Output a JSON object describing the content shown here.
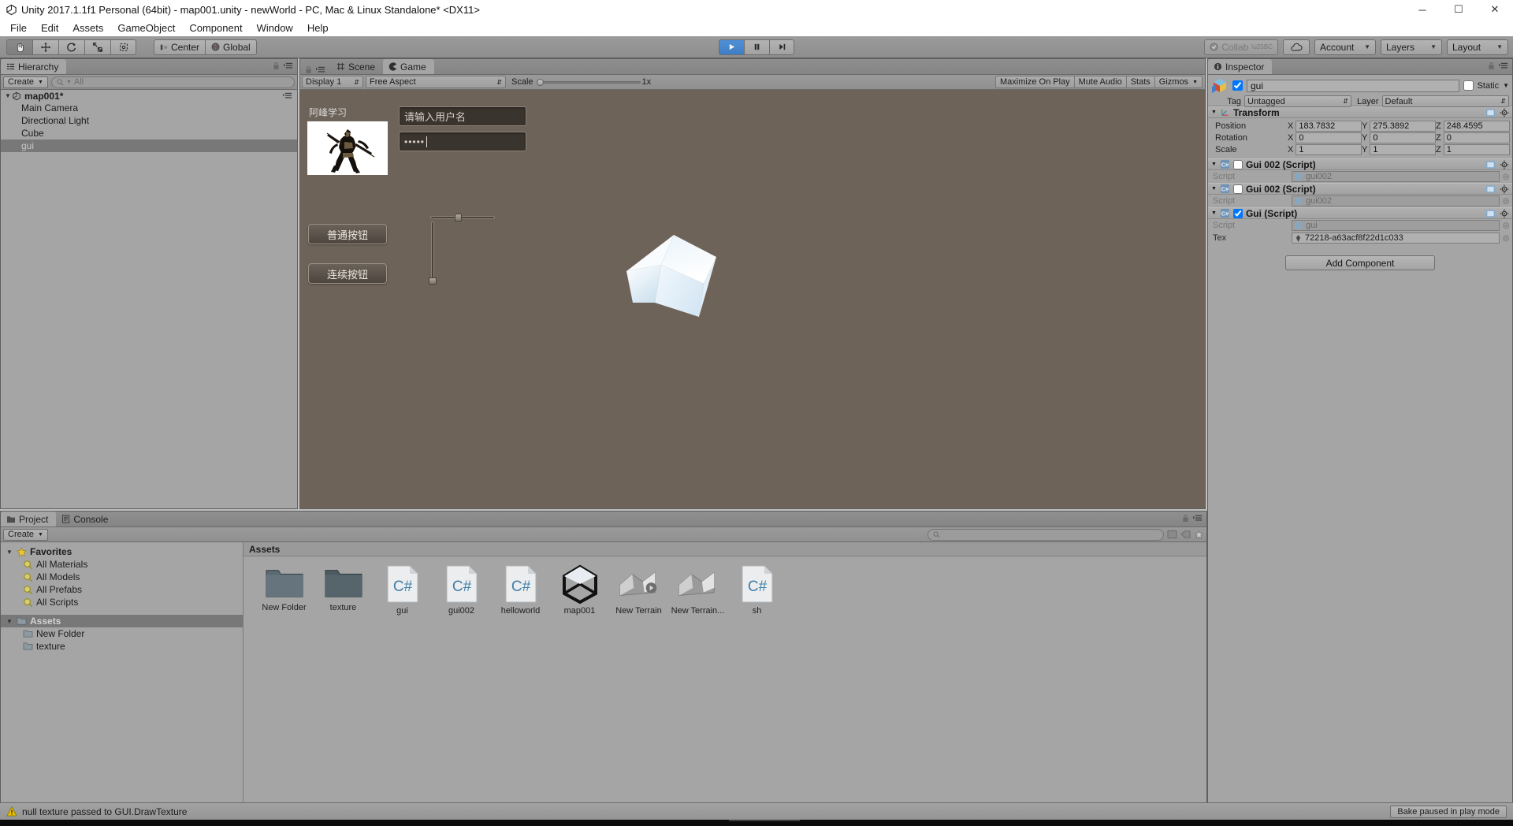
{
  "window": {
    "title": "Unity 2017.1.1f1 Personal (64bit) - map001.unity - newWorld - PC, Mac & Linux Standalone* <DX11>",
    "minimize": "─",
    "maximize": "☐",
    "close": "✕"
  },
  "menubar": {
    "items": [
      "File",
      "Edit",
      "Assets",
      "GameObject",
      "Component",
      "Window",
      "Help"
    ]
  },
  "toolbar": {
    "tools": [
      "hand-tool",
      "move-tool",
      "rotate-tool",
      "scale-tool",
      "rect-tool"
    ],
    "pivot_label": "Center",
    "space_label": "Global",
    "play_label": "▶",
    "pause_label": "‖",
    "step_label": "▶|",
    "collab_label": "Collab",
    "cloud_label": "cloud-icon",
    "account_label": "Account",
    "layers_label": "Layers",
    "layout_label": "Layout"
  },
  "hierarchy": {
    "tab_label": "Hierarchy",
    "create_label": "Create",
    "search_placeholder": "All",
    "scene_name": "map001*",
    "items": [
      {
        "label": "Main Camera",
        "selected": false
      },
      {
        "label": "Directional Light",
        "selected": false
      },
      {
        "label": "Cube",
        "selected": false
      },
      {
        "label": "gui",
        "selected": true
      }
    ]
  },
  "gameview": {
    "tabs": [
      {
        "label": "Scene",
        "active": false
      },
      {
        "label": "Game",
        "active": true
      }
    ],
    "display_label": "Display 1",
    "aspect_label": "Free Aspect",
    "scale_label": "Scale",
    "scale_value": "1x",
    "maximize_label": "Maximize On Play",
    "mute_label": "Mute Audio",
    "stats_label": "Stats",
    "gizmos_label": "Gizmos",
    "gui": {
      "heading": "阿峰学习",
      "username_placeholder": "请输入用户名",
      "password_value": "•••••",
      "button_normal": "普通按钮",
      "button_repeat": "连续按钮",
      "hslider_value": 0.45,
      "vslider_value": 1.0
    }
  },
  "inspector": {
    "tab_label": "Inspector",
    "object_name": "gui",
    "object_enabled": true,
    "static_label": "Static",
    "tag_label": "Tag",
    "tag_value": "Untagged",
    "layer_label": "Layer",
    "layer_value": "Default",
    "components": [
      {
        "name": "Transform",
        "enabled": null,
        "icon": "transform-icon",
        "rows": [
          {
            "label": "Position",
            "x": "183.7832",
            "y": "275.3892",
            "z": "248.4595"
          },
          {
            "label": "Rotation",
            "x": "0",
            "y": "0",
            "z": "0"
          },
          {
            "label": "Scale",
            "x": "1",
            "y": "1",
            "z": "1"
          }
        ]
      },
      {
        "name": "Gui 002 (Script)",
        "enabled": false,
        "icon": "cs-script-icon",
        "script_label": "Script",
        "script_value": "gui002"
      },
      {
        "name": "Gui 002 (Script)",
        "enabled": false,
        "icon": "cs-script-icon",
        "script_label": "Script",
        "script_value": "gui002"
      },
      {
        "name": "Gui (Script)",
        "enabled": true,
        "icon": "cs-script-icon",
        "script_label": "Script",
        "script_value": "gui",
        "tex_label": "Tex",
        "tex_value": "72218-a63acf8f22d1c033"
      }
    ],
    "add_component_label": "Add Component"
  },
  "project": {
    "tabs": [
      {
        "label": "Project",
        "active": true
      },
      {
        "label": "Console",
        "active": false
      }
    ],
    "create_label": "Create",
    "tree": [
      {
        "label": "Favorites",
        "depth": 0,
        "icon": "star-icon",
        "bold": true,
        "selected": false
      },
      {
        "label": "All Materials",
        "depth": 1,
        "icon": "search-icon",
        "bold": false,
        "selected": false
      },
      {
        "label": "All Models",
        "depth": 1,
        "icon": "search-icon",
        "bold": false,
        "selected": false
      },
      {
        "label": "All Prefabs",
        "depth": 1,
        "icon": "search-icon",
        "bold": false,
        "selected": false
      },
      {
        "label": "All Scripts",
        "depth": 1,
        "icon": "search-icon",
        "bold": false,
        "selected": false
      },
      {
        "label": "Assets",
        "depth": 0,
        "icon": "folder-icon",
        "bold": true,
        "selected": true
      },
      {
        "label": "New Folder",
        "depth": 1,
        "icon": "folder-icon",
        "bold": false,
        "selected": false
      },
      {
        "label": "texture",
        "depth": 1,
        "icon": "folder-icon",
        "bold": false,
        "selected": false
      }
    ],
    "breadcrumb": "Assets",
    "assets": [
      {
        "label": "New Folder",
        "icon": "folder-icon"
      },
      {
        "label": "texture",
        "icon": "folder-icon"
      },
      {
        "label": "gui",
        "icon": "cs-script-icon"
      },
      {
        "label": "gui002",
        "icon": "cs-script-icon"
      },
      {
        "label": "helloworld",
        "icon": "cs-script-icon"
      },
      {
        "label": "map001",
        "icon": "unity-scene-icon"
      },
      {
        "label": "New Terrain",
        "icon": "terrain-icon"
      },
      {
        "label": "New Terrain...",
        "icon": "terrain-icon"
      },
      {
        "label": "sh",
        "icon": "cs-script-icon"
      }
    ]
  },
  "statusbar": {
    "message": "null texture passed to GUI.DrawTexture",
    "icon": "warning-icon",
    "bake_label": "Bake paused in play mode"
  },
  "colors": {
    "panel_bg": "#a5a5a5",
    "toolbar_bg": "#939393",
    "game_bg": "#6e6359",
    "selection": "#787878",
    "play_active": "#4285c8",
    "warning": "#e0b010"
  }
}
